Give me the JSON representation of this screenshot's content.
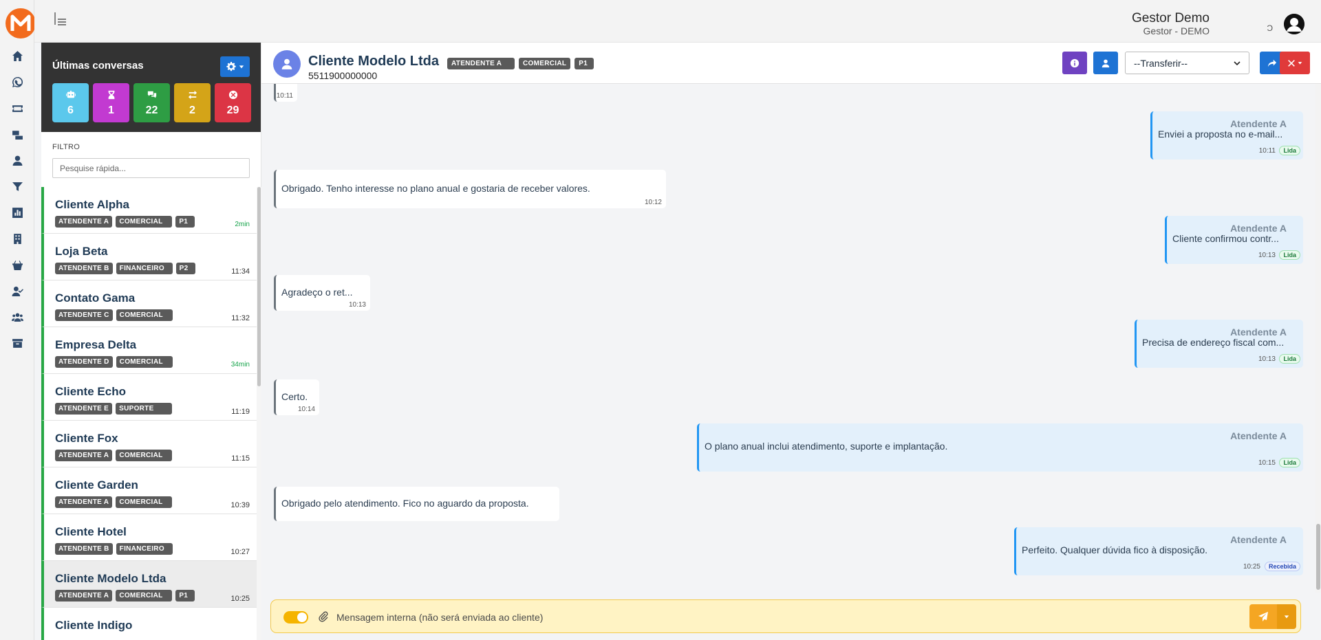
{
  "user": {
    "name": "Gestor Demo",
    "role": "Gestor - DEMO",
    "extra": "Ɔ"
  },
  "panel": {
    "title": "Últimas conversas",
    "stats": [
      {
        "icon": "robot-icon",
        "value": "6",
        "color": "#5bc8ec"
      },
      {
        "icon": "hourglass-icon",
        "value": "1",
        "color": "#c23ad1"
      },
      {
        "icon": "comments-icon",
        "value": "22",
        "color": "#2e9d44"
      },
      {
        "icon": "exchange-icon",
        "value": "2",
        "color": "#d4a418"
      },
      {
        "icon": "times-circle-icon",
        "value": "29",
        "color": "#dc3545"
      }
    ],
    "filter_label": "FILTRO",
    "filter_placeholder": "Pesquise rápida..."
  },
  "conversations": [
    {
      "name": "Cliente Alpha",
      "tags": [
        "ATENDENTE A",
        "COMERCIAL",
        "P1"
      ],
      "time": "2min",
      "time_green": true
    },
    {
      "name": "Loja Beta",
      "tags": [
        "ATENDENTE B",
        "FINANCEIRO",
        "P2"
      ],
      "time": "11:34"
    },
    {
      "name": "Contato Gama",
      "tags": [
        "ATENDENTE C",
        "COMERCIAL"
      ],
      "time": "11:32"
    },
    {
      "name": "Empresa Delta",
      "tags": [
        "ATENDENTE D",
        "COMERCIAL"
      ],
      "time": "34min",
      "time_green": true
    },
    {
      "name": "Cliente Echo",
      "tags": [
        "ATENDENTE E",
        "SUPORTE"
      ],
      "time": "11:19"
    },
    {
      "name": "Cliente Fox",
      "tags": [
        "ATENDENTE A",
        "COMERCIAL"
      ],
      "time": "11:15"
    },
    {
      "name": "Cliente Garden",
      "tags": [
        "ATENDENTE A",
        "COMERCIAL"
      ],
      "time": "10:39"
    },
    {
      "name": "Cliente Hotel",
      "tags": [
        "ATENDENTE B",
        "FINANCEIRO"
      ],
      "time": "10:27"
    },
    {
      "name": "Cliente Modelo Ltda",
      "tags": [
        "ATENDENTE A",
        "COMERCIAL",
        "P1"
      ],
      "time": "10:25",
      "active": true
    },
    {
      "name": "Cliente Indigo",
      "tags": [],
      "time": ""
    }
  ],
  "chat": {
    "name": "Cliente Modelo Ltda",
    "phone": "5511900000000",
    "tags": [
      "ATENDENTE A",
      "COMERCIAL",
      "P1"
    ],
    "transfer_label": "--Transferir--",
    "buttons": {
      "info": "info-icon",
      "contact": "user-card-icon",
      "forward": "share-icon",
      "close": "close-icon"
    }
  },
  "messages": [
    {
      "dir": "in",
      "text": "",
      "time": "10:11"
    },
    {
      "dir": "out",
      "author": "Atendente A",
      "text": "Enviei a proposta no e-mail...",
      "time": "10:11",
      "status": "Lida"
    },
    {
      "dir": "in",
      "text": "Obrigado. Tenho interesse no plano anual e gostaria de receber valores.",
      "time": "10:12"
    },
    {
      "dir": "out",
      "author": "Atendente A",
      "text": "Cliente confirmou contr...",
      "time": "10:13",
      "status": "Lida"
    },
    {
      "dir": "in",
      "text": "Agradeço o ret...",
      "time": "10:13"
    },
    {
      "dir": "out",
      "author": "Atendente A",
      "text": "Precisa de endereço fiscal com...",
      "time": "10:13",
      "status": "Lida"
    },
    {
      "dir": "in",
      "text": "Certo.",
      "time": "10:14"
    },
    {
      "dir": "out",
      "author": "Atendente A",
      "text": "O plano anual inclui atendimento, suporte e implantação.",
      "time": "10:15",
      "status": "Lida"
    },
    {
      "dir": "in",
      "text": "Obrigado pelo atendimento. Fico no aguardo da proposta.",
      "time": ""
    },
    {
      "dir": "out",
      "author": "Atendente A",
      "text": "Perfeito. Qualquer dúvida fico à disposição.",
      "time": "10:25",
      "status": "Recebida"
    }
  ],
  "composer": {
    "placeholder": "Mensagem interna (não será enviada ao cliente)"
  }
}
